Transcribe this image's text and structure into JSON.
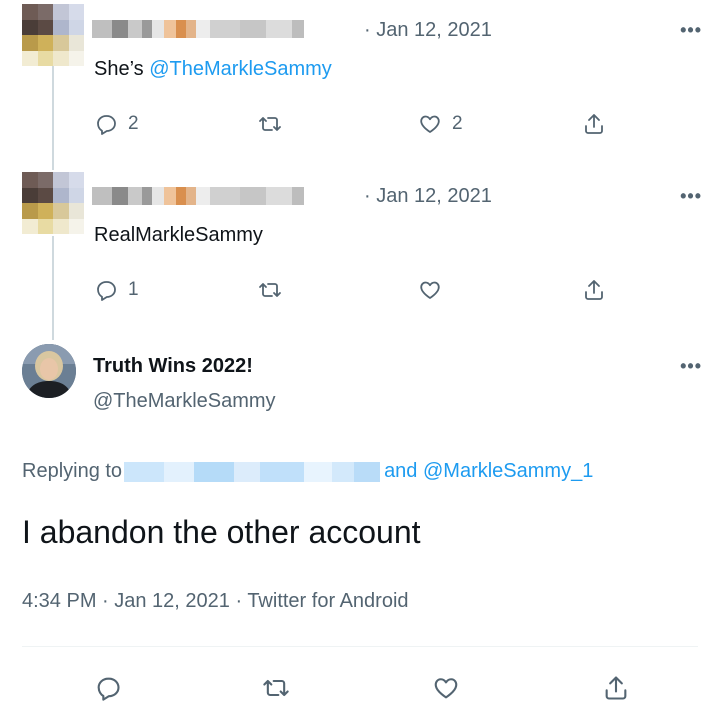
{
  "reply1": {
    "timestamp": "· Jan 12, 2021",
    "text_prefix": "She’s ",
    "mention": "@TheMarkleSammy",
    "reply_count": "2",
    "like_count": "2"
  },
  "reply2": {
    "timestamp": "· Jan 12, 2021",
    "text": "RealMarkleSammy",
    "reply_count": "1"
  },
  "main": {
    "display_name": "Truth Wins 2022!",
    "handle": "@TheMarkleSammy",
    "replying_prefix": "Replying to",
    "replying_suffix": "and @MarkleSammy_1",
    "text": "I abandon the other account",
    "meta": "4:34 PM · Jan 12, 2021 · Twitter for Android"
  },
  "icons": {
    "reply": "reply-icon",
    "retweet": "retweet-icon",
    "like": "heart-icon",
    "share": "share-icon",
    "more": "more-icon"
  },
  "colors": {
    "link": "#1d9bf0",
    "muted": "#536471",
    "text": "#0f1419"
  },
  "more_glyph": "•••"
}
